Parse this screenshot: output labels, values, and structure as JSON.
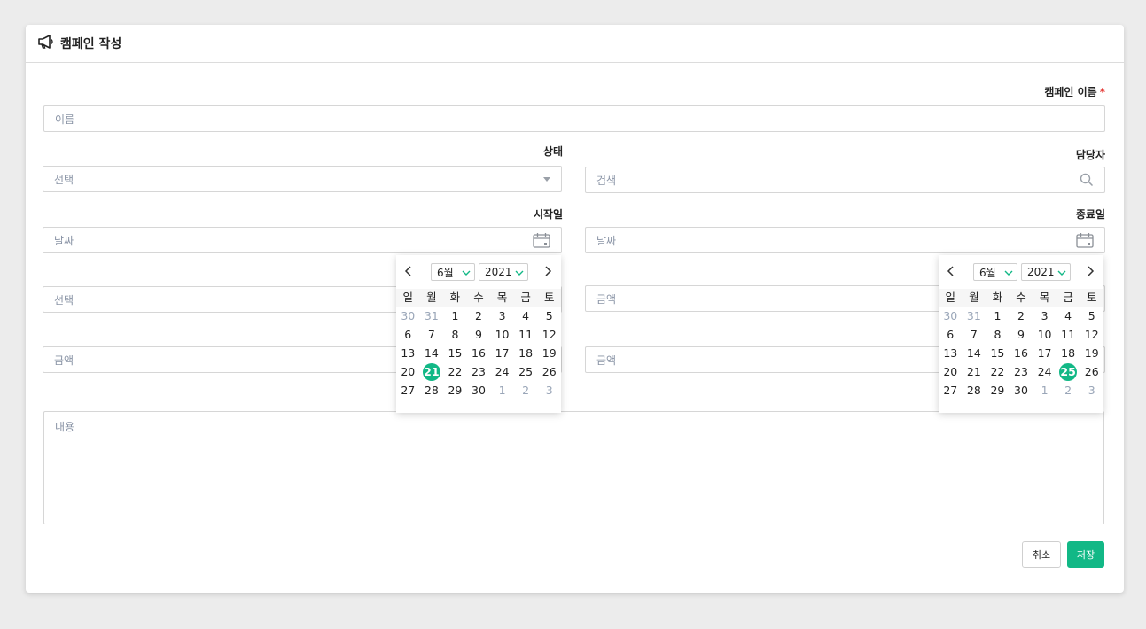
{
  "header": {
    "title": "캠페인 작성",
    "icon": "megaphone-icon"
  },
  "form": {
    "name": {
      "label": "캠페인 이름",
      "required_mark": "*",
      "placeholder": "이름"
    },
    "status": {
      "label": "상태",
      "placeholder": "선택"
    },
    "manager": {
      "label": "담당자",
      "placeholder": "검색"
    },
    "start_date": {
      "label": "시작일",
      "placeholder": "날짜"
    },
    "end_date": {
      "label": "종료일",
      "placeholder": "날짜"
    },
    "row4_left": {
      "placeholder": "선택"
    },
    "row4_right": {
      "placeholder": "금액"
    },
    "row5_left": {
      "placeholder": "금액"
    },
    "row5_right": {
      "placeholder": "금액"
    },
    "content": {
      "placeholder": "내용"
    }
  },
  "buttons": {
    "cancel": "취소",
    "save": "저장"
  },
  "colors": {
    "accent": "#12b886",
    "required": "#e53935"
  },
  "datepickers": [
    {
      "month": "6월",
      "year": "2021",
      "weekdays": [
        "일",
        "월",
        "화",
        "수",
        "목",
        "금",
        "토"
      ],
      "selected": "21",
      "weeks": [
        [
          [
            "30",
            1
          ],
          [
            "31",
            1
          ],
          [
            "1",
            0
          ],
          [
            "2",
            0
          ],
          [
            "3",
            0
          ],
          [
            "4",
            0
          ],
          [
            "5",
            0
          ]
        ],
        [
          [
            "6",
            0
          ],
          [
            "7",
            0
          ],
          [
            "8",
            0
          ],
          [
            "9",
            0
          ],
          [
            "10",
            0
          ],
          [
            "11",
            0
          ],
          [
            "12",
            0
          ]
        ],
        [
          [
            "13",
            0
          ],
          [
            "14",
            0
          ],
          [
            "15",
            0
          ],
          [
            "16",
            0
          ],
          [
            "17",
            0
          ],
          [
            "18",
            0
          ],
          [
            "19",
            0
          ]
        ],
        [
          [
            "20",
            0
          ],
          [
            "21",
            0
          ],
          [
            "22",
            0
          ],
          [
            "23",
            0
          ],
          [
            "24",
            0
          ],
          [
            "25",
            0
          ],
          [
            "26",
            0
          ]
        ],
        [
          [
            "27",
            0
          ],
          [
            "28",
            0
          ],
          [
            "29",
            0
          ],
          [
            "30",
            0
          ],
          [
            "1",
            1
          ],
          [
            "2",
            1
          ],
          [
            "3",
            1
          ]
        ]
      ]
    },
    {
      "month": "6월",
      "year": "2021",
      "weekdays": [
        "일",
        "월",
        "화",
        "수",
        "목",
        "금",
        "토"
      ],
      "selected": "25",
      "weeks": [
        [
          [
            "30",
            1
          ],
          [
            "31",
            1
          ],
          [
            "1",
            0
          ],
          [
            "2",
            0
          ],
          [
            "3",
            0
          ],
          [
            "4",
            0
          ],
          [
            "5",
            0
          ]
        ],
        [
          [
            "6",
            0
          ],
          [
            "7",
            0
          ],
          [
            "8",
            0
          ],
          [
            "9",
            0
          ],
          [
            "10",
            0
          ],
          [
            "11",
            0
          ],
          [
            "12",
            0
          ]
        ],
        [
          [
            "13",
            0
          ],
          [
            "14",
            0
          ],
          [
            "15",
            0
          ],
          [
            "16",
            0
          ],
          [
            "17",
            0
          ],
          [
            "18",
            0
          ],
          [
            "19",
            0
          ]
        ],
        [
          [
            "20",
            0
          ],
          [
            "21",
            0
          ],
          [
            "22",
            0
          ],
          [
            "23",
            0
          ],
          [
            "24",
            0
          ],
          [
            "25",
            0
          ],
          [
            "26",
            0
          ]
        ],
        [
          [
            "27",
            0
          ],
          [
            "28",
            0
          ],
          [
            "29",
            0
          ],
          [
            "30",
            0
          ],
          [
            "1",
            1
          ],
          [
            "2",
            1
          ],
          [
            "3",
            1
          ]
        ]
      ]
    }
  ]
}
